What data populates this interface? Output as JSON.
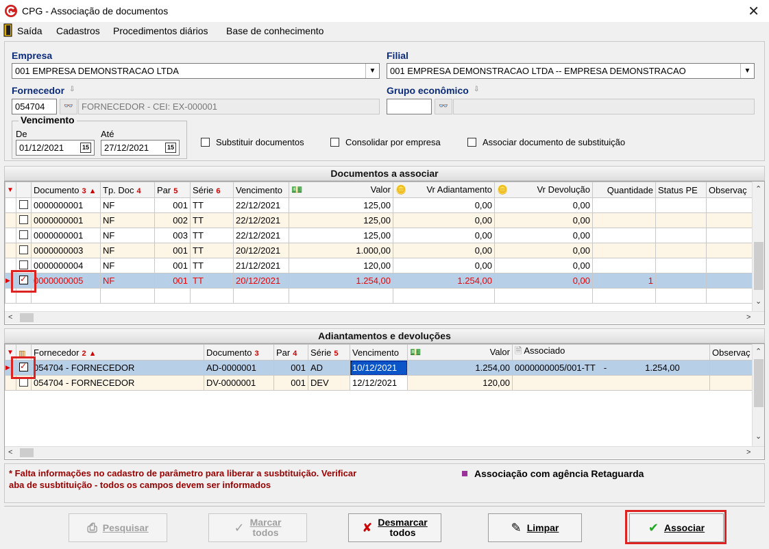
{
  "window": {
    "title": "CPG - Associação de documentos",
    "close_glyph": "✕",
    "logo_icon": "cpg-logo-icon"
  },
  "menu": [
    "Saída",
    "Cadastros",
    "Procedimentos diários",
    "Base de conhecimento"
  ],
  "filters": {
    "empresa_label": "Empresa",
    "empresa_value": "001 EMPRESA DEMONSTRACAO LTDA",
    "filial_label": "Filial",
    "filial_value": "001 EMPRESA DEMONSTRACAO LTDA -- EMPRESA DEMONSTRACAO",
    "fornecedor_label": "Fornecedor",
    "fornecedor_code": "054704",
    "fornecedor_desc": "FORNECEDOR - CEI: EX-000001",
    "grupo_label": "Grupo econômico",
    "grupo_code": "",
    "grupo_desc": "",
    "vencimento_label": "Vencimento",
    "de_label": "De",
    "de_value": "01/12/2021",
    "ate_label": "Até",
    "ate_value": "27/12/2021",
    "cal_glyph": "15",
    "chk_substituir": "Substituir documentos",
    "chk_consolidar": "Consolidar por empresa",
    "chk_associar_sub": "Associar documento de substituição"
  },
  "documentos": {
    "title": "Documentos a associar",
    "headers": {
      "documento": "Documento",
      "documento_sort": "3",
      "tpdoc": "Tp. Doc",
      "tpdoc_sort": "4",
      "par": "Par",
      "par_sort": "5",
      "serie": "Série",
      "serie_sort": "6",
      "vencimento": "Vencimento",
      "valor": "Valor",
      "vr_adiantamento": "Vr Adiantamento",
      "vr_devolucao": "Vr Devolução",
      "quantidade": "Quantidade",
      "status_pe": "Status PE",
      "observacao": "Observaç"
    },
    "rows": [
      {
        "doc": "0000000001",
        "tp": "NF",
        "par": "001",
        "serie": "TT",
        "venc": "22/12/2021",
        "valor": "125,00",
        "adiant": "0,00",
        "devol": "0,00",
        "qtd": "",
        "status": "",
        "obs": ""
      },
      {
        "doc": "0000000001",
        "tp": "NF",
        "par": "002",
        "serie": "TT",
        "venc": "22/12/2021",
        "valor": "125,00",
        "adiant": "0,00",
        "devol": "0,00",
        "qtd": "",
        "status": "",
        "obs": ""
      },
      {
        "doc": "0000000001",
        "tp": "NF",
        "par": "003",
        "serie": "TT",
        "venc": "22/12/2021",
        "valor": "125,00",
        "adiant": "0,00",
        "devol": "0,00",
        "qtd": "",
        "status": "",
        "obs": ""
      },
      {
        "doc": "0000000003",
        "tp": "NF",
        "par": "001",
        "serie": "TT",
        "venc": "20/12/2021",
        "valor": "1.000,00",
        "adiant": "0,00",
        "devol": "0,00",
        "qtd": "",
        "status": "",
        "obs": ""
      },
      {
        "doc": "0000000004",
        "tp": "NF",
        "par": "001",
        "serie": "TT",
        "venc": "21/12/2021",
        "valor": "120,00",
        "adiant": "0,00",
        "devol": "0,00",
        "qtd": "",
        "status": "",
        "obs": ""
      },
      {
        "doc": "0000000005",
        "tp": "NF",
        "par": "001",
        "serie": "TT",
        "venc": "20/12/2021",
        "valor": "1.254,00",
        "adiant": "1.254,00",
        "devol": "0,00",
        "qtd": "1",
        "status": "",
        "obs": ""
      }
    ]
  },
  "adiantamentos": {
    "title": "Adiantamentos e devoluções",
    "headers": {
      "fornecedor": "Fornecedor",
      "fornecedor_sort": "2",
      "documento": "Documento",
      "documento_sort": "3",
      "par": "Par",
      "par_sort": "4",
      "serie": "Série",
      "serie_sort": "5",
      "vencimento": "Vencimento",
      "valor": "Valor",
      "associado": "Associado",
      "observacao": "Observaç"
    },
    "rows": [
      {
        "forn": "054704 - FORNECEDOR",
        "doc": "AD-0000001",
        "par": "001",
        "serie": "AD",
        "venc": "10/12/2021",
        "valor": "1.254,00",
        "assoc": "0000000005/001-TT",
        "assoc_sep": "-",
        "assoc_val": "1.254,00",
        "obs": ""
      },
      {
        "forn": "054704 - FORNECEDOR",
        "doc": "DV-0000001",
        "par": "001",
        "serie": "DEV",
        "venc": "12/12/2021",
        "valor": "120,00",
        "assoc": "",
        "assoc_sep": "",
        "assoc_val": "",
        "obs": ""
      }
    ]
  },
  "footer": {
    "note_line1": "* Falta informações no cadastro de parâmetro para liberar a susbtituição. Verificar",
    "note_line2": "aba de susbtituição - todos os campos devem ser informados",
    "legend": "Associação com agência Retaguarda"
  },
  "buttons": {
    "pesquisar": "Pesquisar",
    "marcar_l1": "Marcar",
    "marcar_l2": "todos",
    "desmarcar_l1": "Desmarcar",
    "desmarcar_l2": "todos",
    "limpar": "Limpar",
    "associar": "Associar"
  },
  "colors": {
    "accent_red": "#d22222",
    "label_blue": "#0a2a7a",
    "selection": "#b8cfe8",
    "legend_square": "#993399"
  }
}
